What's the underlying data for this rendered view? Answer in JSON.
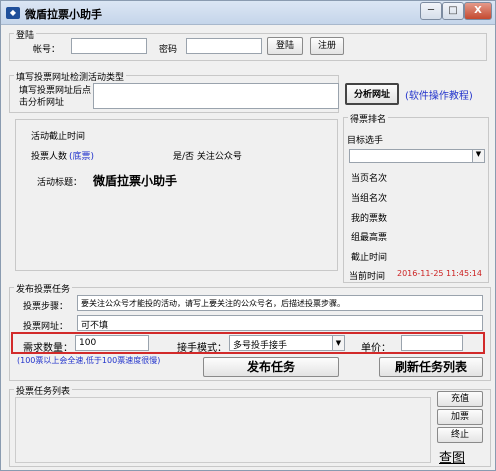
{
  "window": {
    "title": "微盾拉票小助手",
    "title_icon": "app-logo-icon",
    "controls": [
      "─",
      "□",
      "X"
    ]
  },
  "login": {
    "group_label": "登陆",
    "account_label": "帐号：",
    "account_value": "",
    "password_label": "密码",
    "password_value": "",
    "login_button": "登陆",
    "register_button": "注册"
  },
  "url_section": {
    "group_label": "填写投票网址检测活动类型",
    "hint": "填写投票网址后点击分析网址",
    "url_value": "",
    "analyze_button": "分析网址",
    "tutorial_link": "(软件操作教程)"
  },
  "activity": {
    "deadline_label": "活动截止时间",
    "voters_label": "投票人数",
    "voters_link": "(底票)",
    "follow_label": "是/否 关注公众号",
    "title_label": "活动标题：",
    "title_value": "微盾拉票小助手"
  },
  "ranking": {
    "group_label": "得票排名",
    "target_label": "目标选手",
    "target_value": "",
    "items": [
      "当页名次",
      "当组名次",
      "我的票数",
      "组最高票",
      "截止时间",
      "当前时间"
    ],
    "current_time": "2016-11-25 11:45:14"
  },
  "task": {
    "group_label": "发布投票任务",
    "steps_label": "投票步骤：",
    "steps_value": "要关注公众号才能投的活动，请写上要关注的公众号名，后描述投票步骤。",
    "url_label": "投票网址：",
    "url_value": "可不填",
    "quantity_label": "需求数量：",
    "quantity_value": "100",
    "mode_label": "接手模式：",
    "mode_value": "多号投手接手",
    "price_label": "单价：",
    "price_value": "",
    "note": "(100票以上会全速,低于100票速度很慢)",
    "publish_button": "发布任务",
    "refresh_button": "刷新任务列表"
  },
  "task_list": {
    "group_label": "投票任务列表",
    "recharge_button": "充值",
    "add_votes_button": "加票",
    "stop_button": "终止",
    "view_button": "查图"
  },
  "colors": {
    "highlight": "#d22a2a",
    "link": "#2233cc",
    "time_red": "#cc2222"
  }
}
